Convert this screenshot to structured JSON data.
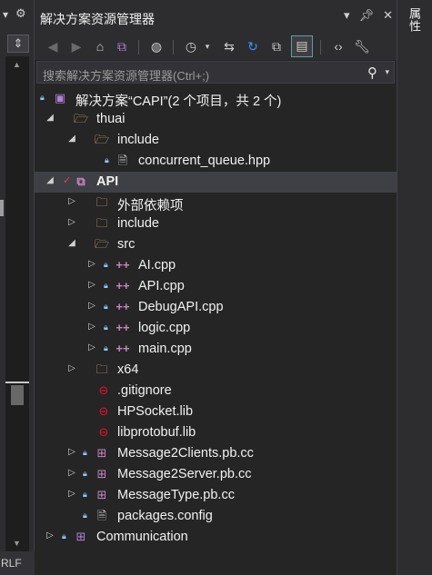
{
  "window": {
    "title": "解决方案资源管理器",
    "right_tab": "属性",
    "left_status": "RLF"
  },
  "search": {
    "placeholder": "搜索解决方案资源管理器(Ctrl+;)"
  },
  "colors": {
    "panel_bg": "#252526",
    "chrome_bg": "#2d2d30",
    "selected_row": "#3f3f46",
    "folder": "#dcb67a",
    "cpp_icon": "#c586c0",
    "lock": "#8ecbff",
    "error_icon": "#e81123"
  },
  "toolbar_icons": [
    "back-icon",
    "forward-icon",
    "home-icon",
    "vs-switch-icon",
    "globe-icon",
    "history-icon",
    "sync-icon",
    "refresh-icon",
    "collapse-all-icon",
    "show-all-files-icon",
    "view-code-icon",
    "properties-wrench-icon"
  ],
  "tree": [
    {
      "label": "解决方案“CAPI”(2 个项目，共 2 个)",
      "icon": "solution-icon",
      "expanded": true
    },
    {
      "label": "thuai",
      "icon": "folder-open-icon",
      "expanded": true
    },
    {
      "label": "include",
      "icon": "folder-open-icon",
      "expanded": true
    },
    {
      "label": "concurrent_queue.hpp",
      "icon": "header-file-icon"
    },
    {
      "label": "API",
      "icon": "cpp-project-icon",
      "expanded": true,
      "selected": true
    },
    {
      "label": "外部依赖项",
      "icon": "external-deps-icon",
      "expanded": false
    },
    {
      "label": "include",
      "icon": "folder-icon",
      "expanded": false
    },
    {
      "label": "src",
      "icon": "folder-open-icon",
      "expanded": true
    },
    {
      "label": "AI.cpp",
      "icon": "cpp-file-icon",
      "expanded": false
    },
    {
      "label": "API.cpp",
      "icon": "cpp-file-icon",
      "expanded": false
    },
    {
      "label": "DebugAPI.cpp",
      "icon": "cpp-file-icon",
      "expanded": false
    },
    {
      "label": "logic.cpp",
      "icon": "cpp-file-icon",
      "expanded": false
    },
    {
      "label": "main.cpp",
      "icon": "cpp-file-icon",
      "expanded": false
    },
    {
      "label": "x64",
      "icon": "folder-icon",
      "expanded": false
    },
    {
      "label": ".gitignore",
      "icon": "excluded-file-icon"
    },
    {
      "label": "HPSocket.lib",
      "icon": "excluded-file-icon"
    },
    {
      "label": "libprotobuf.lib",
      "icon": "excluded-file-icon"
    },
    {
      "label": "Message2Clients.pb.cc",
      "icon": "cc-file-icon",
      "expanded": false
    },
    {
      "label": "Message2Server.pb.cc",
      "icon": "cc-file-icon",
      "expanded": false
    },
    {
      "label": "MessageType.pb.cc",
      "icon": "cc-file-icon",
      "expanded": false
    },
    {
      "label": "packages.config",
      "icon": "config-file-icon"
    },
    {
      "label": "Communication",
      "icon": "project-icon",
      "expanded": false
    }
  ]
}
